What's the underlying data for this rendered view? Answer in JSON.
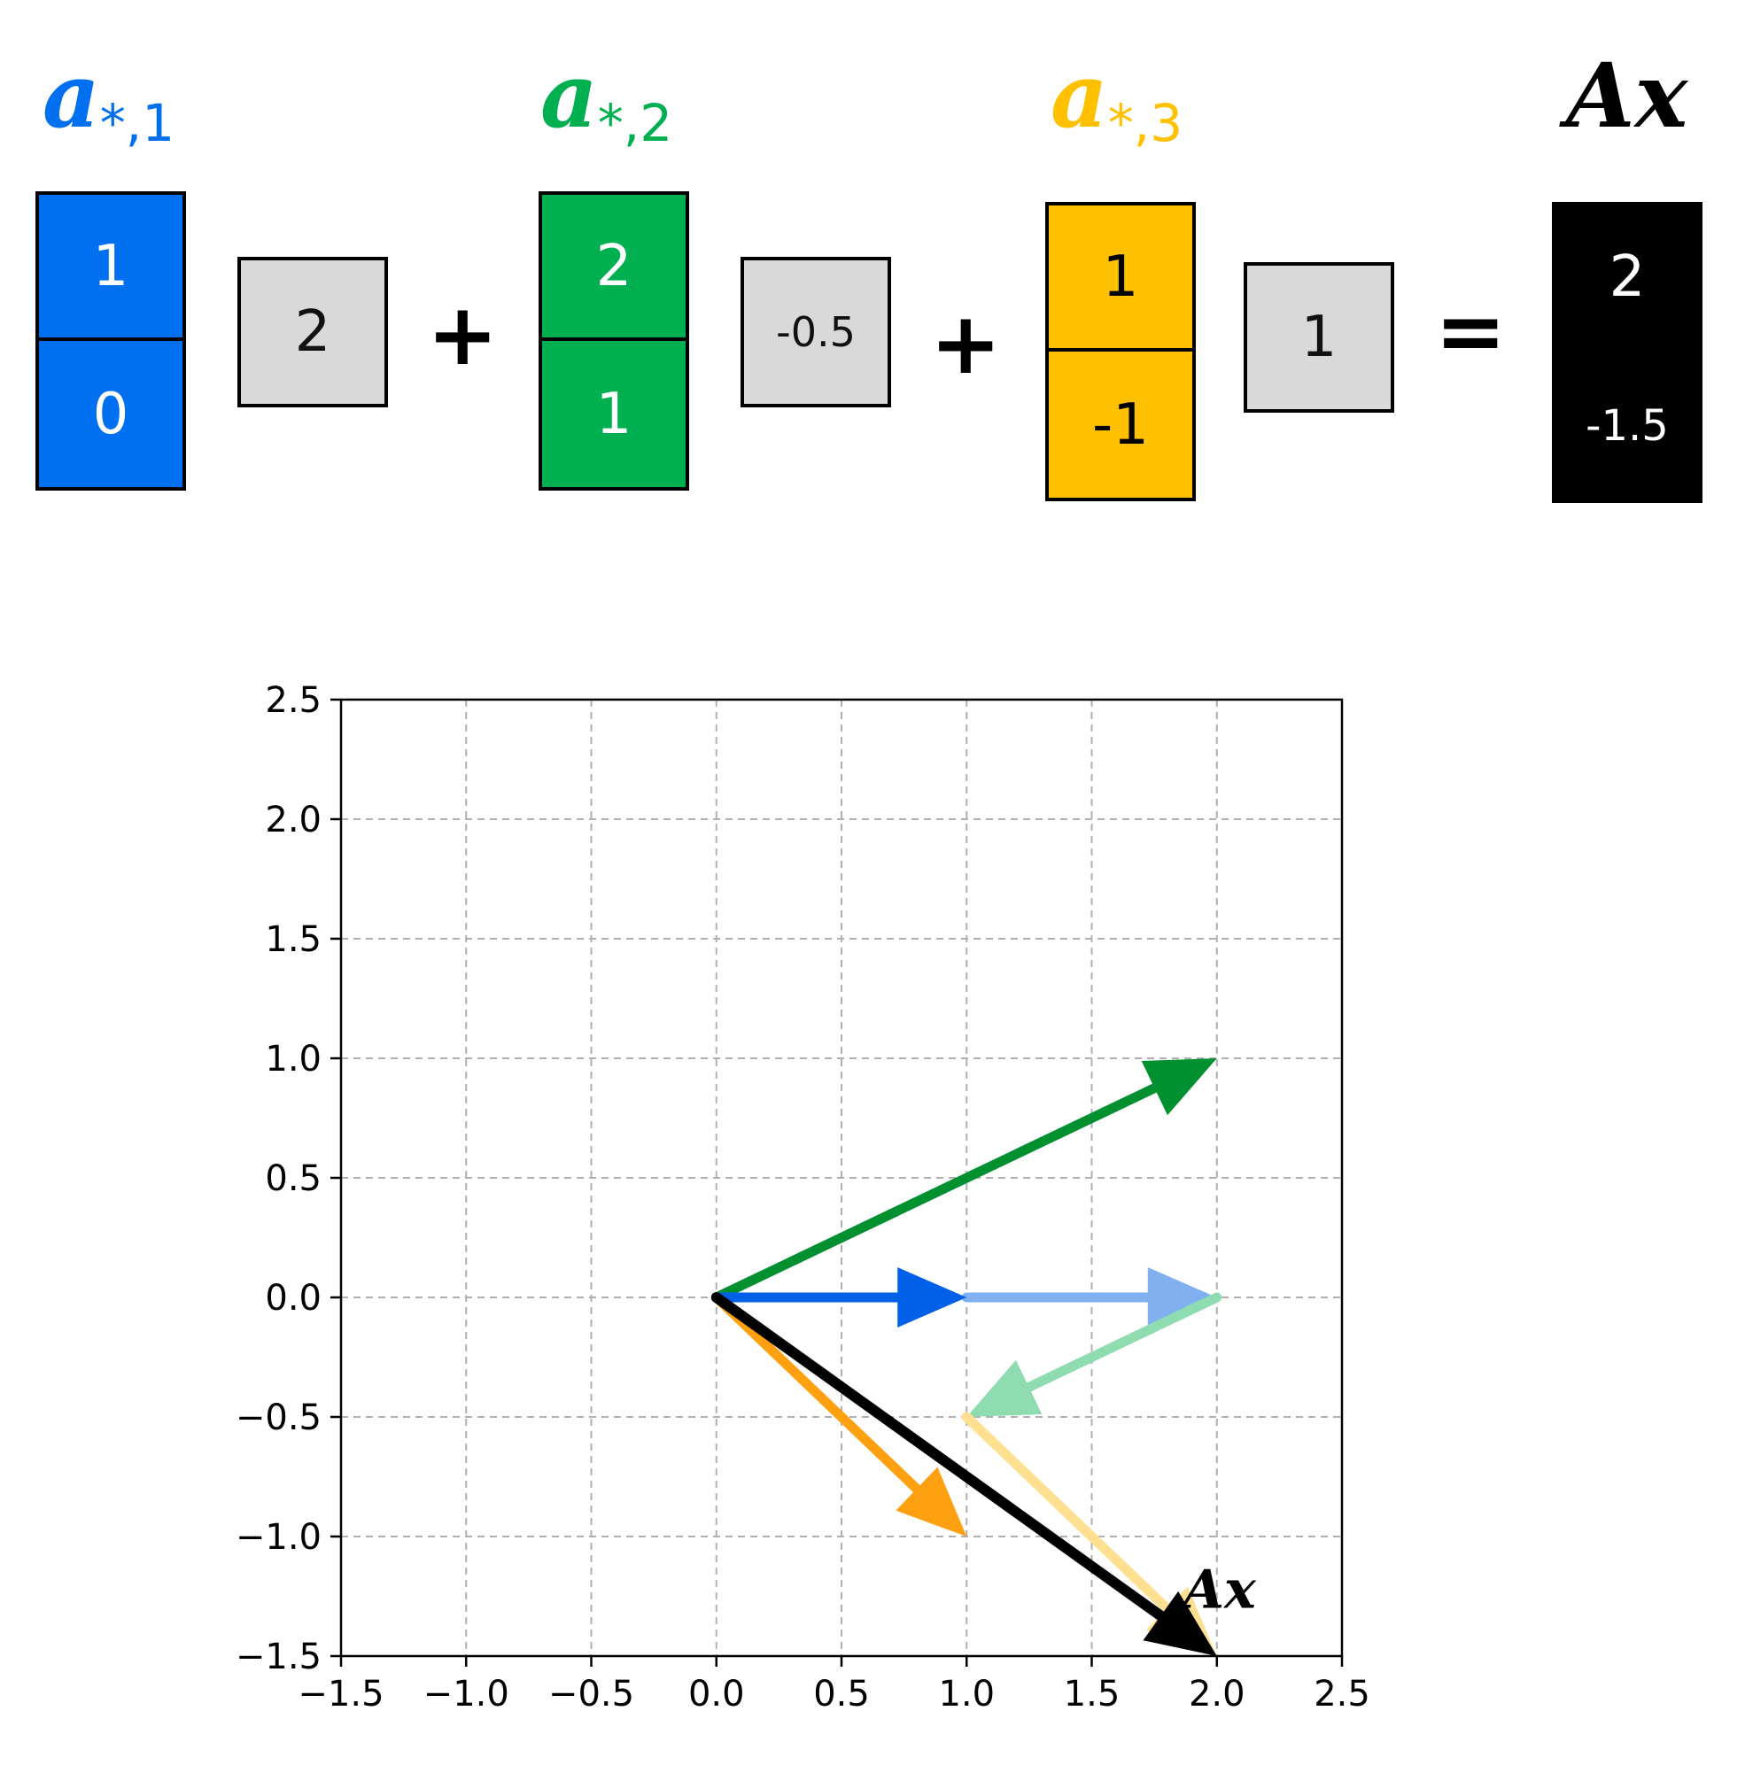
{
  "equation": {
    "columns": [
      {
        "symbol": "a",
        "subscript": "*,1",
        "values": [
          "1",
          "0"
        ],
        "scalar": "2",
        "color": "#0070f0",
        "text_color": "#ffffff"
      },
      {
        "symbol": "a",
        "subscript": "*,2",
        "values": [
          "2",
          "1"
        ],
        "scalar": "-0.5",
        "color": "#00b050",
        "text_color": "#ffffff"
      },
      {
        "symbol": "a",
        "subscript": "*,3",
        "values": [
          "1",
          "-1"
        ],
        "scalar": "1",
        "color": "#ffc000",
        "text_color": "#000000"
      }
    ],
    "plus_1": "+",
    "plus_2": "+",
    "equals": "=",
    "result": {
      "label": "Ax",
      "values": [
        "2",
        "-1.5"
      ],
      "color": "#000000",
      "text_color": "#ffffff"
    }
  },
  "chart_data": {
    "type": "vector-plot",
    "xlim": [
      -1.5,
      2.5
    ],
    "ylim": [
      -1.5,
      2.5
    ],
    "x_ticks": [
      "−1.5",
      "−1.0",
      "−0.5",
      "0.0",
      "0.5",
      "1.0",
      "1.5",
      "2.0",
      "2.5"
    ],
    "y_ticks": [
      "−1.5",
      "−1.0",
      "−0.5",
      "0.0",
      "0.5",
      "1.0",
      "1.5",
      "2.0",
      "2.5"
    ],
    "grid": true,
    "arrows": [
      {
        "id": "a1",
        "from": [
          0,
          0
        ],
        "to": [
          1,
          0
        ],
        "color": "#0060e8",
        "opacity": 1.0
      },
      {
        "id": "a2",
        "from": [
          0,
          0
        ],
        "to": [
          2,
          1
        ],
        "color": "#009030",
        "opacity": 1.0
      },
      {
        "id": "a3",
        "from": [
          0,
          0
        ],
        "to": [
          1,
          -1
        ],
        "color": "#ffa010",
        "opacity": 1.0
      },
      {
        "id": "a1-scaled",
        "from": [
          1,
          0
        ],
        "to": [
          2,
          0
        ],
        "color": "#80b0f0",
        "opacity": 1.0
      },
      {
        "id": "a2-scaled",
        "from": [
          2,
          0
        ],
        "to": [
          1,
          -0.5
        ],
        "color": "#8fdcb0",
        "opacity": 1.0
      },
      {
        "id": "a3-scaled",
        "from": [
          1,
          -0.5
        ],
        "to": [
          2,
          -1.5
        ],
        "color": "#ffe090",
        "opacity": 1.0
      },
      {
        "id": "Ax",
        "from": [
          0,
          0
        ],
        "to": [
          2,
          -1.5
        ],
        "color": "#000000",
        "opacity": 1.0
      }
    ],
    "annotation": {
      "text": "Ax",
      "at": [
        1.9,
        -1.15
      ]
    }
  }
}
